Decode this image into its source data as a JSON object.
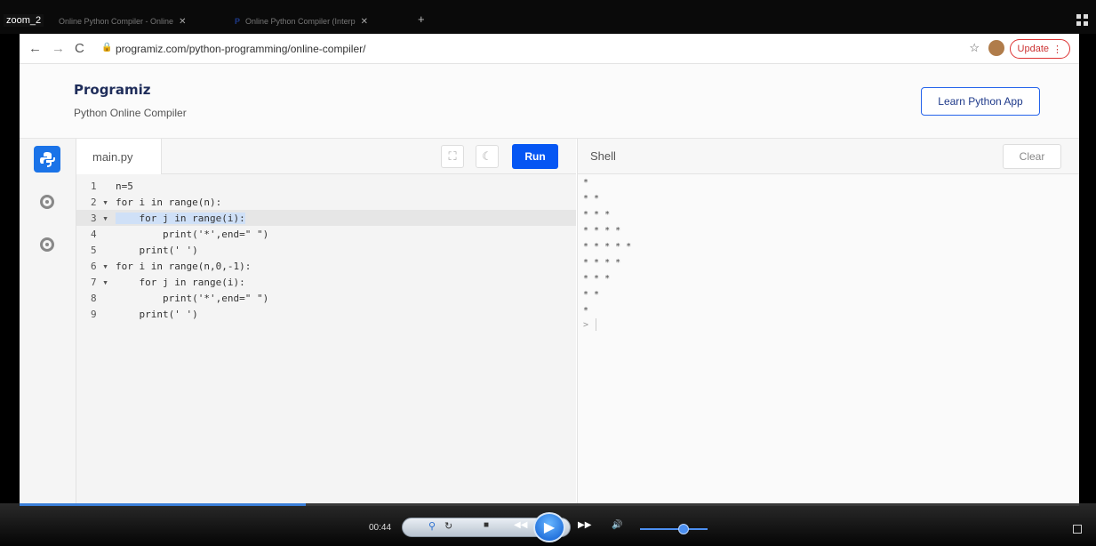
{
  "window": {
    "zoom_label": "zoom_2"
  },
  "tabs": [
    {
      "label": "Online Python Compiler - Online"
    },
    {
      "label": "Online Python Compiler (Interp"
    }
  ],
  "browser": {
    "url": "programiz.com/python-programming/online-compiler/",
    "update_label": "Update"
  },
  "site": {
    "logo": "Programiz",
    "subtitle": "Python Online Compiler",
    "learn_button": "Learn Python App"
  },
  "editor": {
    "file_name": "main.py",
    "run_label": "Run",
    "lines": [
      {
        "num": "1",
        "code": "n=5"
      },
      {
        "num": "2 ▾",
        "code": "for i in range(n):"
      },
      {
        "num": "3 ▾",
        "code": "    for j in range(i):"
      },
      {
        "num": "4",
        "code": "        print('*',end=\" \")"
      },
      {
        "num": "5",
        "code": "    print(' ')"
      },
      {
        "num": "6 ▾",
        "code": "for i in range(n,0,-1):"
      },
      {
        "num": "7 ▾",
        "code": "    for j in range(i):"
      },
      {
        "num": "8",
        "code": "        print('*',end=\" \")"
      },
      {
        "num": "9",
        "code": "    print(' ')"
      }
    ]
  },
  "shell": {
    "title": "Shell",
    "clear_label": "Clear",
    "output": [
      "*",
      "* *",
      "* * *",
      "* * * *",
      "* * * * *",
      "* * * *",
      "* * *",
      "* *",
      "*"
    ],
    "prompt": ">"
  },
  "player": {
    "time": "00:44",
    "progress_fraction": 0.27,
    "volume_fraction": 0.65
  }
}
